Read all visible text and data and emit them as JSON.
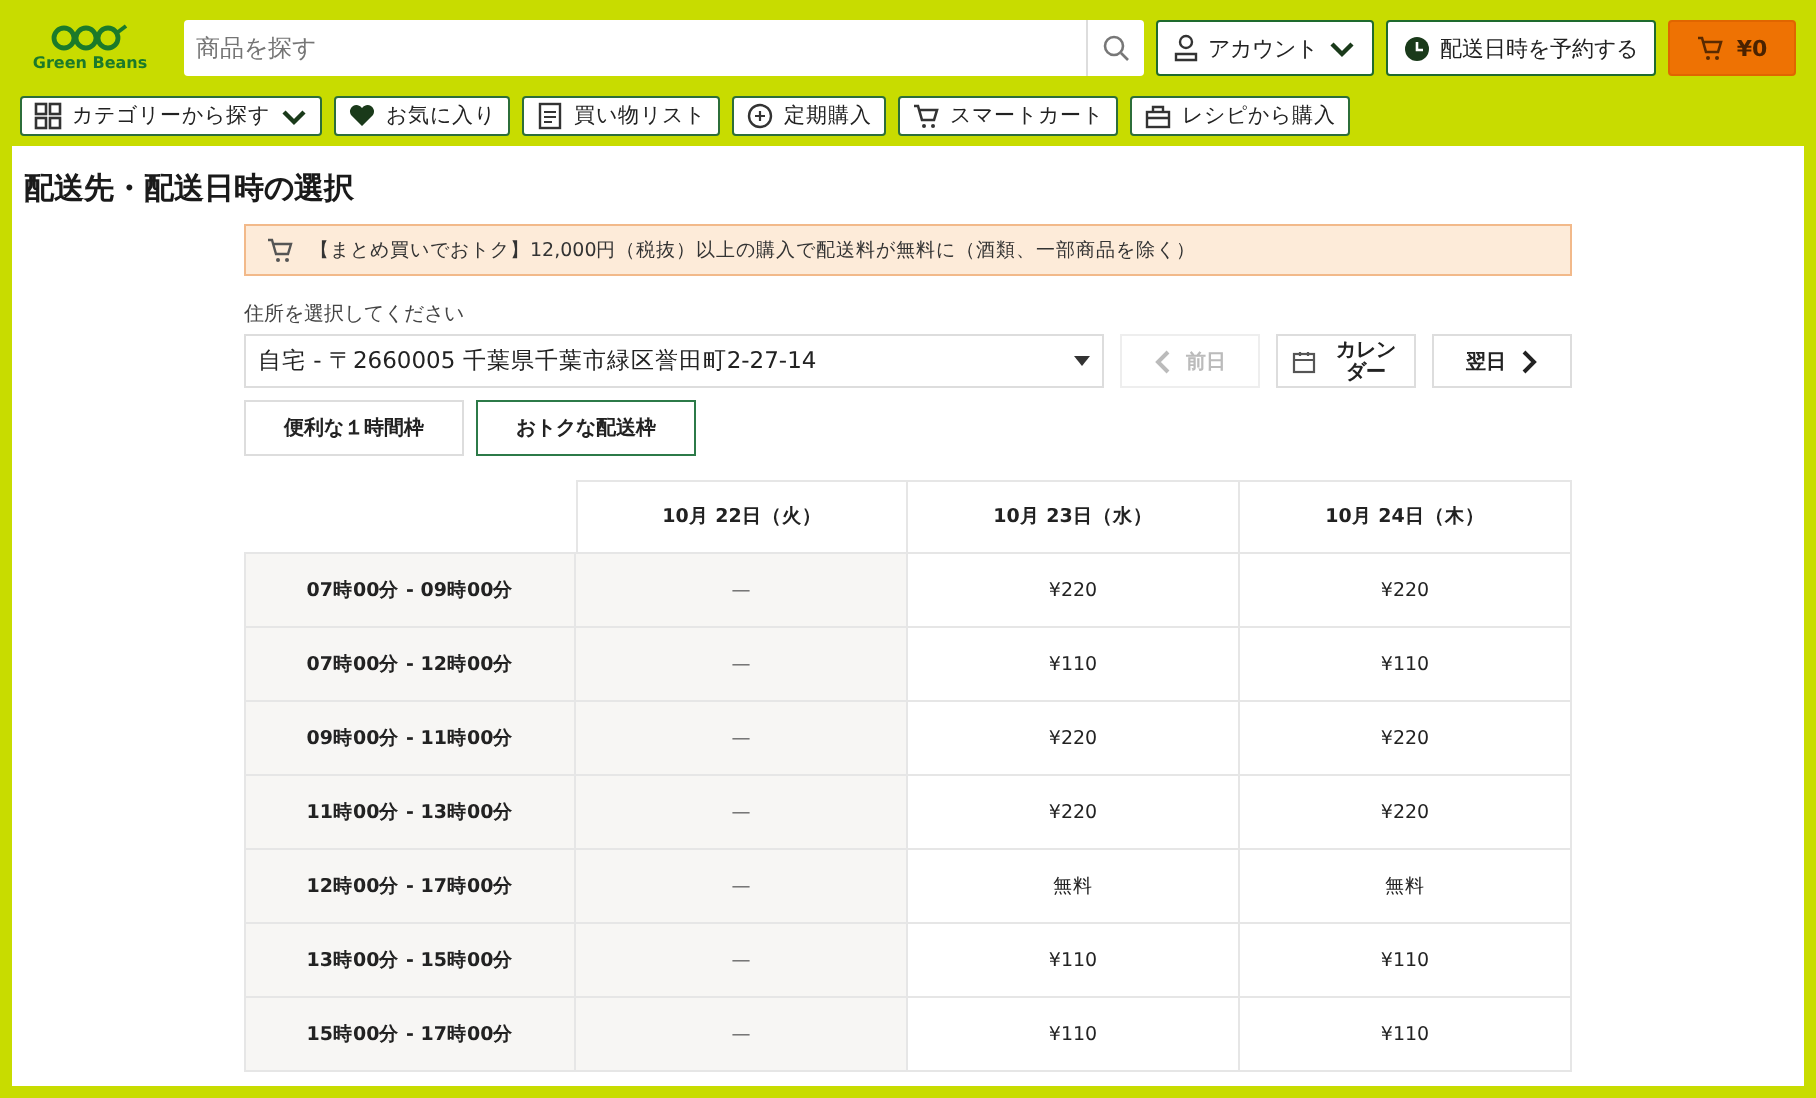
{
  "header": {
    "logo": {
      "text": "Green Beans"
    },
    "search": {
      "placeholder": "商品を探す"
    },
    "account": {
      "label": "アカウント"
    },
    "reserve": {
      "label": "配送日時を予約する"
    },
    "cart": {
      "label": "¥0"
    }
  },
  "nav": [
    {
      "label": "カテゴリーから探す",
      "kind": "category"
    },
    {
      "label": "お気に入り",
      "kind": "favorite"
    },
    {
      "label": "買い物リスト",
      "kind": "list"
    },
    {
      "label": "定期購入",
      "kind": "subscription"
    },
    {
      "label": "スマートカート",
      "kind": "cart"
    },
    {
      "label": "レシピから購入",
      "kind": "recipe"
    }
  ],
  "page_title": "配送先・配送日時の選択",
  "notice": "【まとめ買いでおトク】12,000円（税抜）以上の購入で配送料が無料に（酒類、一部商品を除く）",
  "address": {
    "label": "住所を選択してください",
    "value": "自宅 - 〒2660005 千葉県千葉市緑区誉田町2-27-14"
  },
  "date_nav": {
    "prev": {
      "label": "前日",
      "disabled": true
    },
    "calendar": {
      "label": "カレンダー"
    },
    "next": {
      "label": "翌日",
      "disabled": false
    }
  },
  "slot_tabs": [
    {
      "label": "便利な１時間枠",
      "selected": false
    },
    {
      "label": "おトクな配送枠",
      "selected": true
    }
  ],
  "table": {
    "columns": [
      "10月 22日（火）",
      "10月 23日（水）",
      "10月 24日（木）"
    ],
    "rows": [
      {
        "time": "07時00分 - 09時00分",
        "cells": [
          "—",
          "¥220",
          "¥220"
        ]
      },
      {
        "time": "07時00分 - 12時00分",
        "cells": [
          "—",
          "¥110",
          "¥110"
        ]
      },
      {
        "time": "09時00分 - 11時00分",
        "cells": [
          "—",
          "¥220",
          "¥220"
        ]
      },
      {
        "time": "11時00分 - 13時00分",
        "cells": [
          "—",
          "¥220",
          "¥220"
        ]
      },
      {
        "time": "12時00分 - 17時00分",
        "cells": [
          "—",
          "無料",
          "無料"
        ]
      },
      {
        "time": "13時00分 - 15時00分",
        "cells": [
          "—",
          "¥110",
          "¥110"
        ]
      },
      {
        "time": "15時00分 - 17時00分",
        "cells": [
          "—",
          "¥110",
          "¥110"
        ]
      }
    ]
  }
}
